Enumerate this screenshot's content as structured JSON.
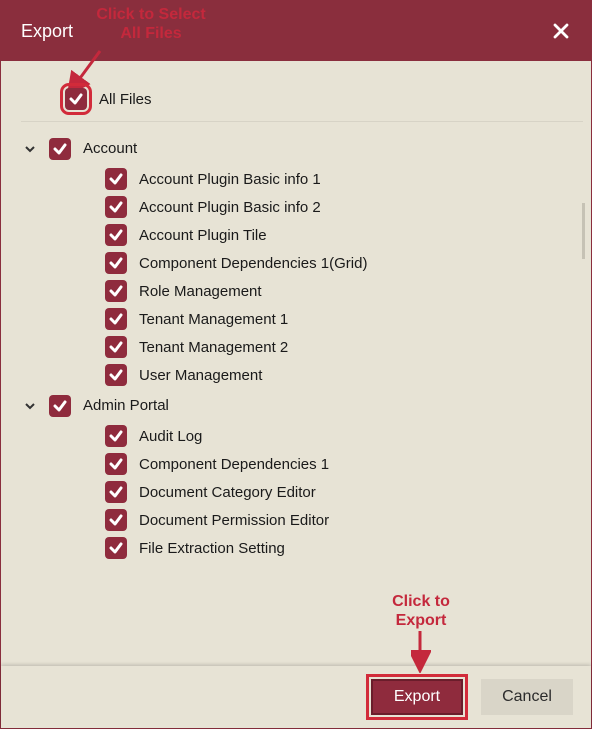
{
  "header": {
    "title": "Export",
    "close_icon": "close"
  },
  "tree": {
    "root": {
      "label": "All Files",
      "checked": true
    },
    "groups": [
      {
        "label": "Account",
        "expanded": true,
        "checked": true,
        "children": [
          {
            "label": "Account Plugin Basic info 1",
            "checked": true
          },
          {
            "label": "Account Plugin Basic info 2",
            "checked": true
          },
          {
            "label": "Account Plugin Tile",
            "checked": true
          },
          {
            "label": "Component Dependencies 1(Grid)",
            "checked": true
          },
          {
            "label": "Role Management",
            "checked": true
          },
          {
            "label": "Tenant Management 1",
            "checked": true
          },
          {
            "label": "Tenant Management 2",
            "checked": true
          },
          {
            "label": "User Management",
            "checked": true
          }
        ]
      },
      {
        "label": "Admin Portal",
        "expanded": true,
        "checked": true,
        "children": [
          {
            "label": "Audit Log",
            "checked": true
          },
          {
            "label": "Component Dependencies 1",
            "checked": true
          },
          {
            "label": "Document Category Editor",
            "checked": true
          },
          {
            "label": "Document Permission Editor",
            "checked": true
          },
          {
            "label": "File Extraction Setting",
            "checked": true
          }
        ]
      }
    ]
  },
  "footer": {
    "export_label": "Export",
    "cancel_label": "Cancel"
  },
  "annotations": {
    "select_all": "Click to Select\nAll Files",
    "export_btn": "Click to\nExport"
  },
  "colors": {
    "brand": "#8f2b3d",
    "callout": "#c4283c"
  }
}
